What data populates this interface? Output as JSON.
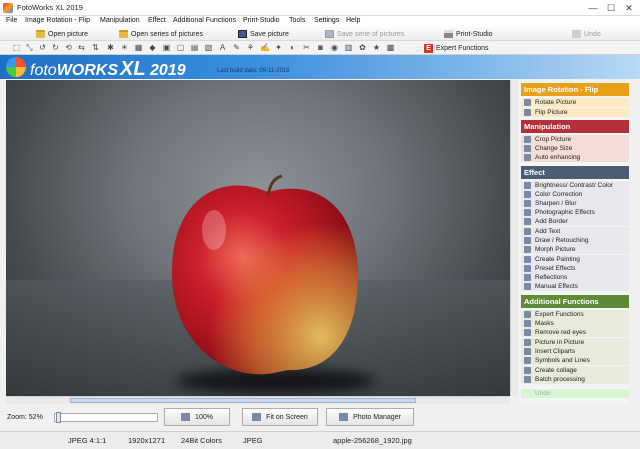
{
  "window": {
    "title": "FotoWorks XL 2019",
    "controls": {
      "minimize": "—",
      "maximize": "☐",
      "close": "✕"
    }
  },
  "menu": [
    "File",
    "Image Rotation - Flip",
    "Manipulation",
    "Effect",
    "Additional Functions",
    "Print-Studio",
    "Tools",
    "Settings",
    "Help"
  ],
  "toolbar": {
    "open_picture": "Open picture",
    "open_series": "Open series of pictures",
    "save_picture": "Save picture",
    "save_series": "Save serie of pictures",
    "print_studio": "Print-Studio",
    "undo": "Undo",
    "expert_functions": "Expert Functions"
  },
  "banner": {
    "logo_foto": "foto",
    "logo_works": "WORKS",
    "logo_xl": "XL",
    "logo_year": "2019",
    "build": "Last build date: 09-11-2018"
  },
  "panel": {
    "sections": [
      {
        "title": "Image Rotation - Flip",
        "color": "#e8a019",
        "items": [
          "Rotate Picture",
          "Flip Picture"
        ]
      },
      {
        "title": "Manipulation",
        "color": "#b3303a",
        "items": [
          "Crop Picture",
          "Change Size",
          "Auto enhancing"
        ]
      },
      {
        "title": "Effect",
        "color": "#4b5d74",
        "items": [
          "Brightness/ Contrast/ Color",
          "Color Correction",
          "Sharpen / Blur",
          "Photographic Effects",
          "Add Border",
          "Add Text",
          "Draw / Retouching",
          "Morph Picture",
          "Create Painting",
          "Preset Effects",
          "Reflections",
          "Manual Effects"
        ]
      },
      {
        "title": "Additional Functions",
        "color": "#5e8a36",
        "items": [
          "Expert Functions",
          "Masks",
          "Remove red eyes",
          "Picture in Picture",
          "Insert Cliparts",
          "Symbols and Lines",
          "Create collage",
          "Batch processing"
        ]
      }
    ],
    "undo": "Undo"
  },
  "bottom": {
    "zoom_label": "Zoom: 52%",
    "zoom_value": 0.52,
    "btn_100": "100%",
    "btn_fit": "Fit on Screen",
    "btn_photo_manager": "Photo Manager"
  },
  "status": {
    "format": "JPEG  4:1:1",
    "dimensions": "1920x1271",
    "colors": "24Bit Colors",
    "type": "JPEG",
    "filename": "apple-256268_1920.jpg"
  }
}
